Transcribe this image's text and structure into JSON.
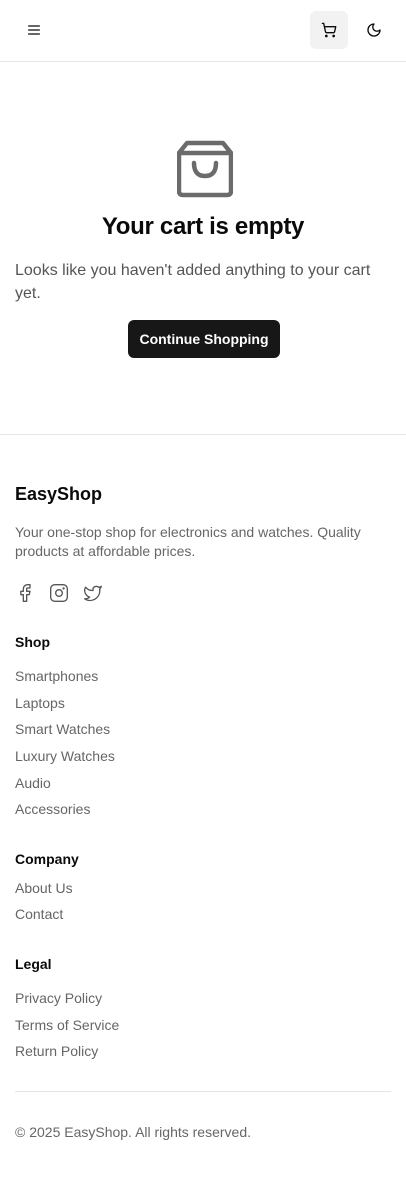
{
  "header": {
    "menu_icon": "menu-icon",
    "cart_icon": "shopping-cart-icon",
    "theme_icon": "moon-icon"
  },
  "empty_cart": {
    "icon": "shopping-bag-icon",
    "title": "Your cart is empty",
    "message": "Looks like you haven't added anything to your cart yet.",
    "button_label": "Continue Shopping"
  },
  "footer": {
    "brand": "EasyShop",
    "tagline": "Your one-stop shop for electronics and watches. Quality products at affordable prices.",
    "social_icons": [
      "facebook-icon",
      "instagram-icon",
      "twitter-icon"
    ],
    "sections": [
      {
        "title": "Shop",
        "links": [
          "Smartphones",
          "Laptops",
          "Smart Watches",
          "Luxury Watches",
          "Audio",
          "Accessories"
        ]
      },
      {
        "title": "Company",
        "links": [
          "About Us",
          "Contact"
        ]
      },
      {
        "title": "Legal",
        "links": [
          "Privacy Policy",
          "Terms of Service",
          "Return Policy"
        ]
      }
    ],
    "copyright": "© 2025 EasyShop. All rights reserved."
  },
  "colors": {
    "primary_button": "#171717",
    "muted_text": "#666666",
    "border": "#e5e5e5",
    "cart_button_bg": "#f2f2f2"
  }
}
